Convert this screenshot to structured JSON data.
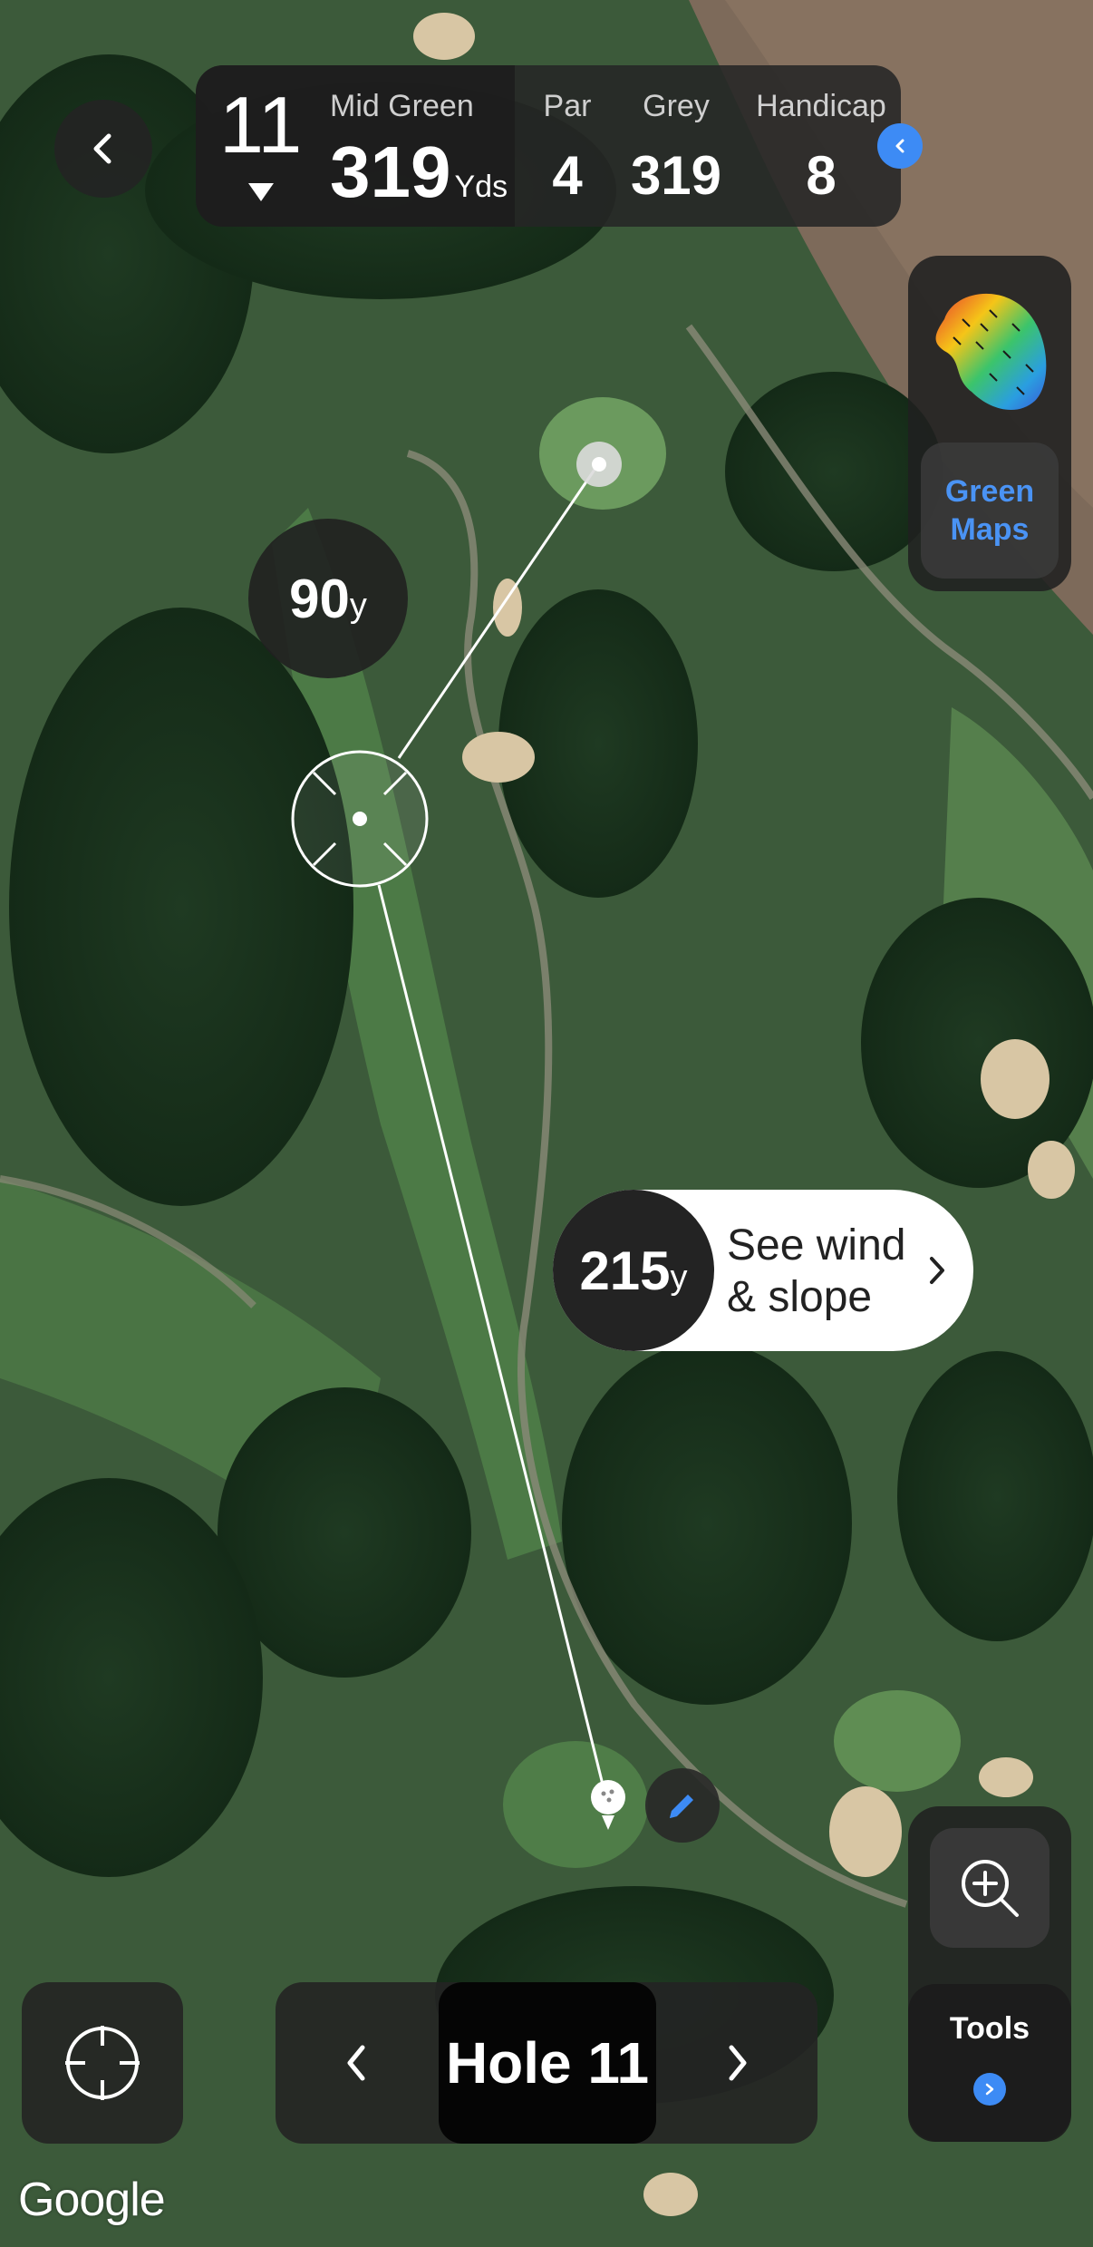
{
  "header": {
    "hole_number": "11",
    "mid_green_label": "Mid Green",
    "mid_green_value": "319",
    "mid_green_unit": "Yds",
    "par_label": "Par",
    "par_value": "4",
    "tee_label": "Grey",
    "tee_value": "319",
    "handicap_label": "Handicap",
    "handicap_value": "8"
  },
  "green_maps": {
    "label_line1": "Green",
    "label_line2": "Maps"
  },
  "distances": {
    "to_green": {
      "value": "90",
      "unit": "y"
    },
    "to_target": {
      "value": "215",
      "unit": "y"
    }
  },
  "wind_slope": {
    "line1": "See wind",
    "line2": "& slope"
  },
  "tools": {
    "label": "Tools"
  },
  "hole_nav": {
    "label": "Hole 11"
  },
  "map": {
    "attribution": "Google"
  },
  "colors": {
    "accent": "#3d8bf5",
    "green_maps_text": "#4a93f4",
    "panel": "#262626"
  },
  "icons": [
    "back-chevron-icon",
    "caret-down-icon",
    "expand-chevron-icon",
    "green-heatmap-icon",
    "target-reticle-icon",
    "edit-pencil-icon",
    "zoom-in-icon",
    "locate-crosshair-icon",
    "prev-chevron-icon",
    "next-chevron-icon",
    "golf-ball-icon"
  ]
}
